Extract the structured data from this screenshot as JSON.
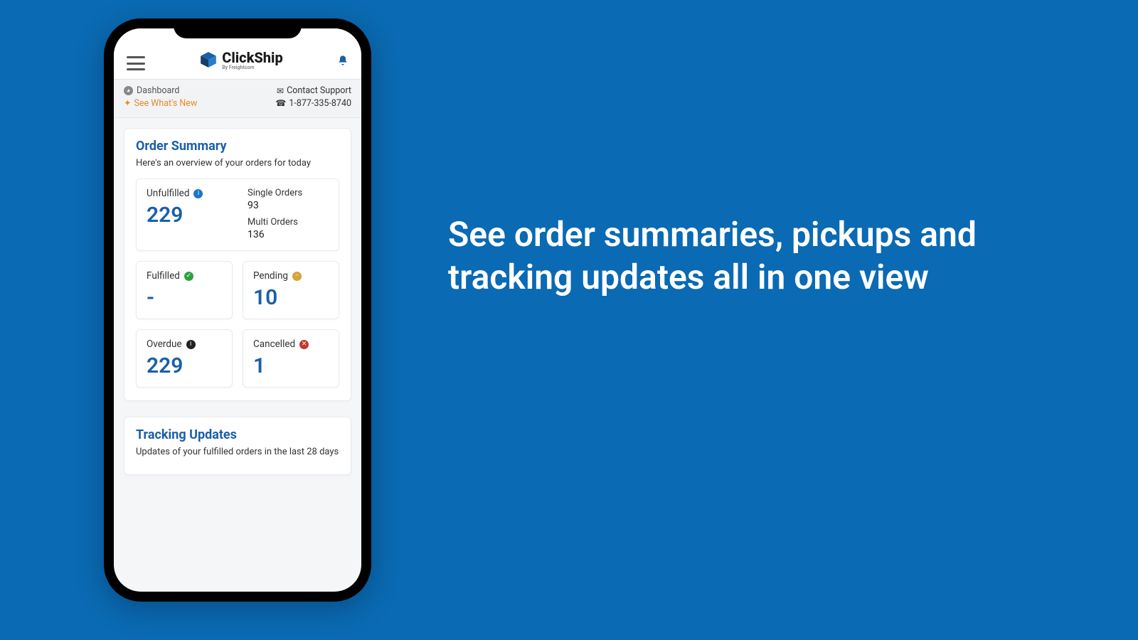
{
  "marketing": {
    "headline": "See order summaries, pickups and tracking updates all in one view"
  },
  "app": {
    "brand_name": "ClickShip",
    "brand_tagline": "By Freightcom"
  },
  "subheader": {
    "breadcrumb": "Dashboard",
    "whats_new": "See What's New",
    "contact_support": "Contact Support",
    "phone_number": "1-877-335-8740"
  },
  "order_summary": {
    "title": "Order Summary",
    "description": "Here's an overview of your orders for today",
    "unfulfilled": {
      "label": "Unfulfilled",
      "value": "229"
    },
    "single_orders": {
      "label": "Single Orders",
      "value": "93"
    },
    "multi_orders": {
      "label": "Multi Orders",
      "value": "136"
    },
    "fulfilled": {
      "label": "Fulfilled",
      "value": "-"
    },
    "pending": {
      "label": "Pending",
      "value": "10"
    },
    "overdue": {
      "label": "Overdue",
      "value": "229"
    },
    "cancelled": {
      "label": "Cancelled",
      "value": "1"
    }
  },
  "tracking": {
    "title": "Tracking Updates",
    "description": "Updates of your fulfilled orders in the last 28 days"
  }
}
